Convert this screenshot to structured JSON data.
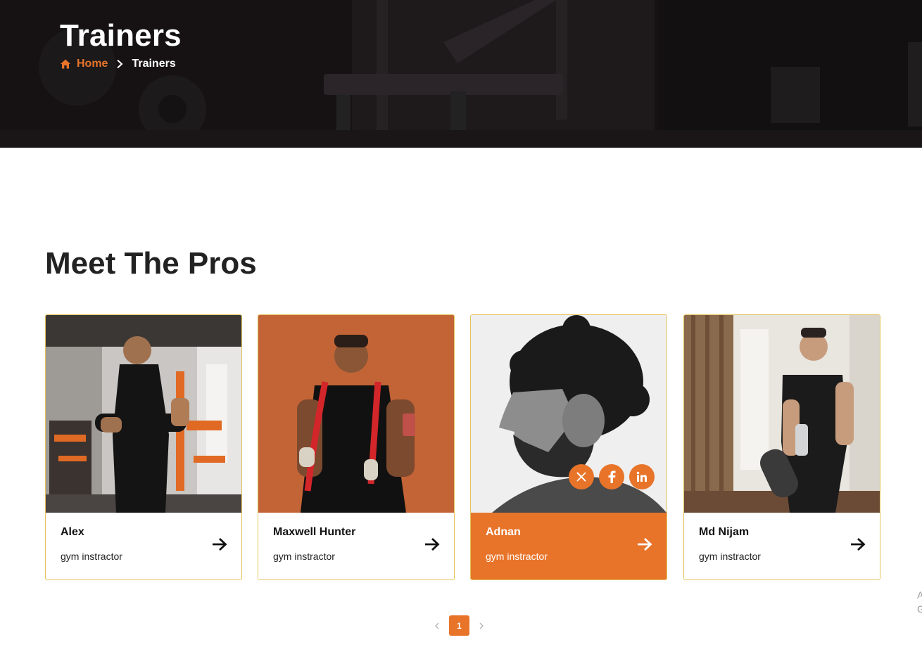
{
  "hero": {
    "title": "Trainers",
    "breadcrumb": {
      "home": "Home",
      "current": "Trainers"
    }
  },
  "section": {
    "title": "Meet The Pros"
  },
  "trainers": [
    {
      "name": "Alex",
      "role": "gym instractor",
      "active": false
    },
    {
      "name": "Maxwell Hunter",
      "role": "gym instractor",
      "active": false
    },
    {
      "name": "Adnan",
      "role": "gym instractor",
      "active": true,
      "socials": [
        "x-icon",
        "facebook-icon",
        "linkedin-icon"
      ]
    },
    {
      "name": "Md Nijam",
      "role": "gym instractor",
      "active": false
    }
  ],
  "pagination": {
    "current": "1"
  },
  "edge_text": [
    "A",
    "G"
  ],
  "colors": {
    "accent": "#e8742a",
    "card_border": "#e3c35a",
    "heading": "#222222"
  }
}
